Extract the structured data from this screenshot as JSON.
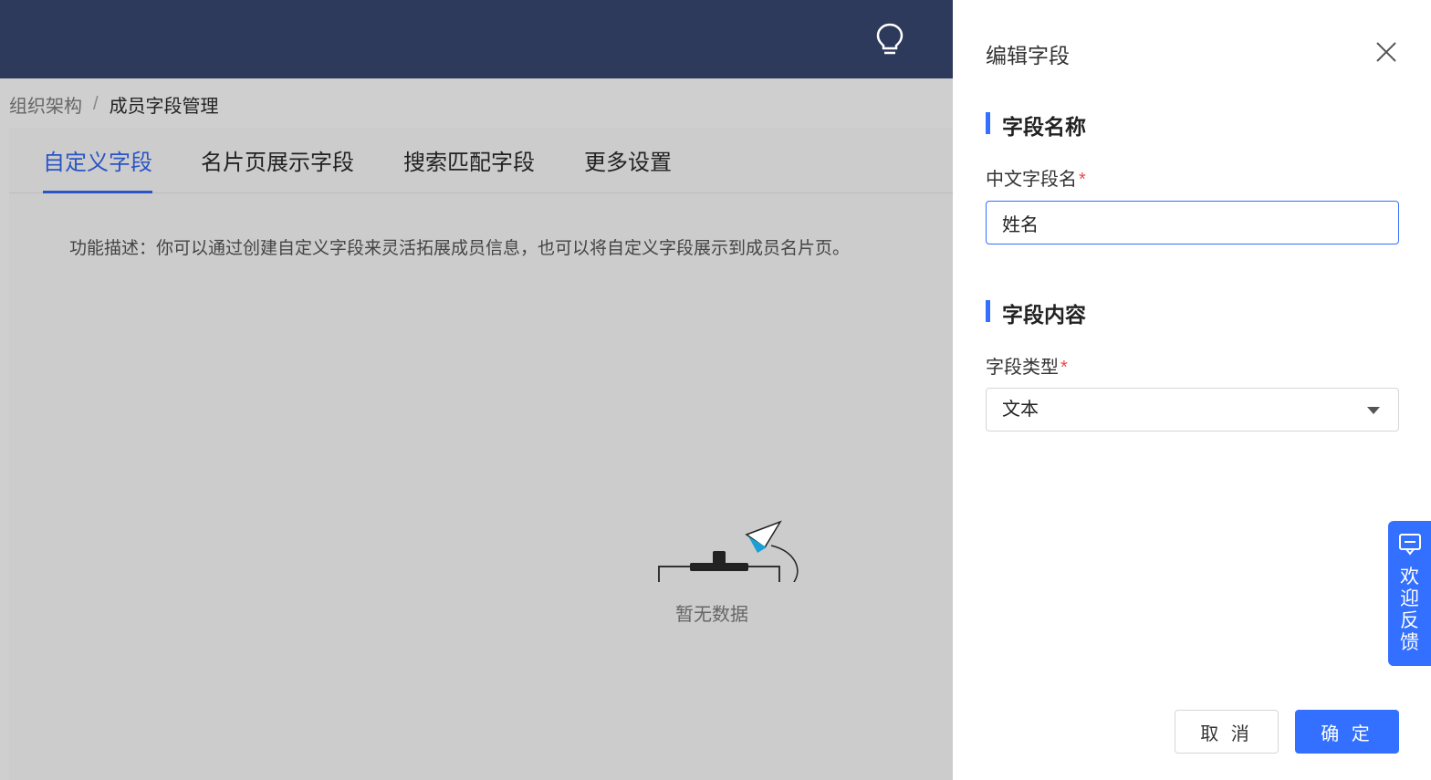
{
  "breadcrumb": {
    "parent": "组织架构",
    "separator": "/",
    "current": "成员字段管理"
  },
  "tabs": [
    {
      "label": "自定义字段",
      "active": true
    },
    {
      "label": "名片页展示字段",
      "active": false
    },
    {
      "label": "搜索匹配字段",
      "active": false
    },
    {
      "label": "更多设置",
      "active": false
    }
  ],
  "description": "功能描述：你可以通过创建自定义字段来灵活拓展成员信息，也可以将自定义字段展示到成员名片页。",
  "empty_state": {
    "text": "暂无数据"
  },
  "drawer": {
    "title": "编辑字段",
    "section_name": {
      "title": "字段名称",
      "label": "中文字段名",
      "required_mark": "*",
      "value": "姓名"
    },
    "section_content": {
      "title": "字段内容",
      "label": "字段类型",
      "required_mark": "*",
      "value": "文本"
    },
    "cancel_label": "取 消",
    "ok_label": "确 定"
  },
  "feedback": {
    "chars": [
      "欢",
      "迎",
      "反",
      "馈"
    ]
  },
  "colors": {
    "topbar": "#2e3a5c",
    "accent": "#3370ff",
    "tab_active": "#2a55c4",
    "required": "#e84a4a"
  }
}
